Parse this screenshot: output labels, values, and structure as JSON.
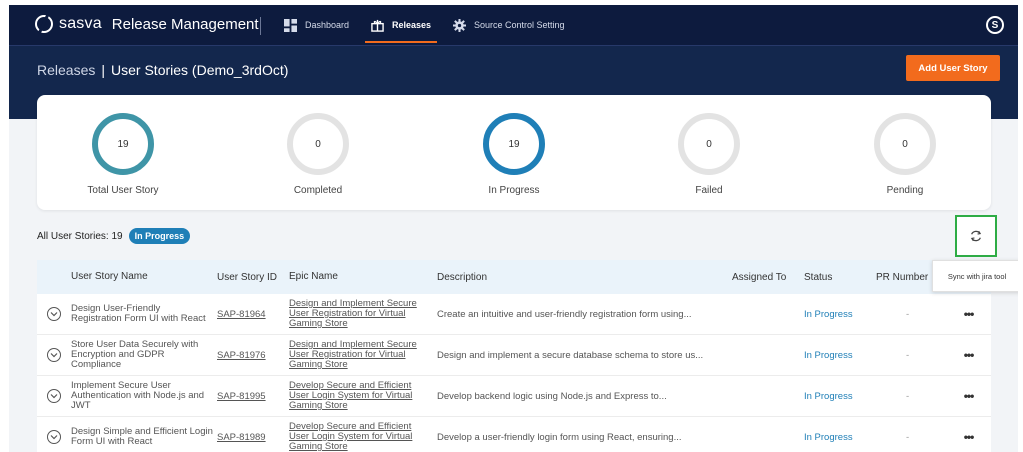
{
  "nav": {
    "brand_name": "sasva",
    "app_name": "Release Management",
    "items": [
      {
        "label": "Dashboard",
        "icon": "dashboard-icon"
      },
      {
        "label": "Releases",
        "icon": "releases-icon"
      },
      {
        "label": "Source Control Setting",
        "icon": "gear-icon"
      }
    ],
    "active_item": "Releases",
    "avatar_initial": "S"
  },
  "header": {
    "breadcrumb_link": "Releases",
    "breadcrumb_sep": "|",
    "breadcrumb_current": "User Stories (Demo_3rdOct)",
    "add_button": "Add User Story"
  },
  "summary": [
    {
      "label": "Total User Story",
      "value": "19",
      "ring": "teal"
    },
    {
      "label": "Completed",
      "value": "0",
      "ring": "grey"
    },
    {
      "label": "In Progress",
      "value": "19",
      "ring": "blue"
    },
    {
      "label": "Failed",
      "value": "0",
      "ring": "grey"
    },
    {
      "label": "Pending",
      "value": "0",
      "ring": "grey"
    }
  ],
  "list": {
    "count_label": "All User Stories: 19",
    "filter_badge": "In Progress",
    "sync_tooltip": "Sync with jira tool"
  },
  "table": {
    "columns": [
      "User Story Name",
      "User Story ID",
      "Epic Name",
      "Description",
      "Assigned To",
      "Status",
      "PR Number"
    ],
    "rows": [
      {
        "name": "Design User-Friendly Registration Form UI with React",
        "id": "SAP-81964",
        "epic": "Design and Implement Secure User Registration for Virtual Gaming Store",
        "desc": "Create an intuitive and user-friendly registration form using...",
        "assigned": "",
        "status": "In Progress",
        "pr": "-"
      },
      {
        "name": "Store User Data Securely with Encryption and GDPR Compliance",
        "id": "SAP-81976",
        "epic": "Design and Implement Secure User Registration for Virtual Gaming Store",
        "desc": "Design and implement a secure database schema to store us...",
        "assigned": "",
        "status": "In Progress",
        "pr": "-"
      },
      {
        "name": "Implement Secure User Authentication with Node.js and JWT",
        "id": "SAP-81995",
        "epic": "Develop Secure and Efficient User Login System for Virtual Gaming Store",
        "desc": "Develop backend logic using Node.js and Express to...",
        "assigned": "",
        "status": "In Progress",
        "pr": "-"
      },
      {
        "name": "Design Simple and Efficient Login Form UI with React",
        "id": "SAP-81989",
        "epic": "Develop Secure and Efficient User Login System for Virtual Gaming Store",
        "desc": "Develop a user-friendly login form using React, ensuring...",
        "assigned": "",
        "status": "In Progress",
        "pr": "-"
      }
    ]
  },
  "colors": {
    "nav_bg": "#0d1b3e",
    "band_bg": "#13274d",
    "accent_orange": "#f26b1d",
    "progress_blue": "#1f7fb7",
    "total_teal": "#3f95a7",
    "highlight_green": "#2eac45"
  }
}
